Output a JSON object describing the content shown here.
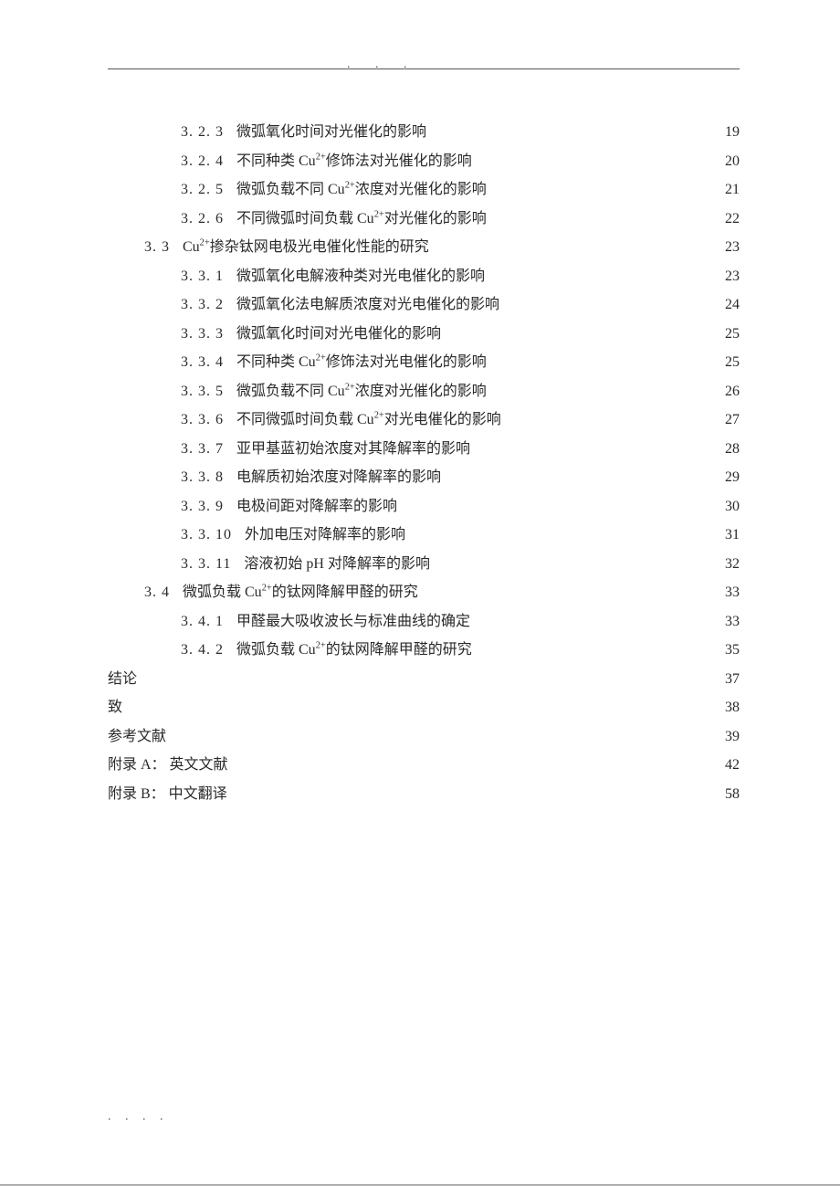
{
  "header_dots": ". . .",
  "footer_dots": ". . . .",
  "toc": [
    {
      "indent": 2,
      "num": "3. 2. 3",
      "title_html": "微弧氧化时间对光催化的影响",
      "page": "19"
    },
    {
      "indent": 2,
      "num": "3. 2. 4",
      "title_html": "不同种类 Cu<sup>2+</sup>修饰法对光催化的影响",
      "page": "20"
    },
    {
      "indent": 2,
      "num": "3. 2. 5",
      "title_html": "微弧负载不同 Cu<sup>2+</sup>浓度对光催化的影响",
      "page": "21"
    },
    {
      "indent": 2,
      "num": "3. 2. 6",
      "title_html": "不同微弧时间负载 Cu<sup>2+</sup>对光催化的影响",
      "page": "22"
    },
    {
      "indent": 1,
      "num": "3. 3",
      "title_html": "Cu<sup>2+</sup>掺杂钛网电极光电催化性能的研究",
      "page": "23"
    },
    {
      "indent": 2,
      "num": "3. 3. 1",
      "title_html": "微弧氧化电解液种类对光电催化的影响",
      "page": "23"
    },
    {
      "indent": 2,
      "num": "3. 3. 2",
      "title_html": "微弧氧化法电解质浓度对光电催化的影响",
      "page": "24"
    },
    {
      "indent": 2,
      "num": "3. 3. 3",
      "title_html": "微弧氧化时间对光电催化的影响",
      "page": "25"
    },
    {
      "indent": 2,
      "num": "3. 3. 4",
      "title_html": " 不同种类 Cu<sup>2+</sup>修饰法对光电催化的影响",
      "page": "25"
    },
    {
      "indent": 2,
      "num": "3. 3. 5",
      "title_html": "微弧负载不同 Cu<sup>2+</sup>浓度对光催化的影响",
      "page": "26"
    },
    {
      "indent": 2,
      "num": "3. 3. 6",
      "title_html": "不同微弧时间负载 Cu<sup>2+</sup>对光电催化的影响",
      "page": "27"
    },
    {
      "indent": 2,
      "num": "3. 3. 7",
      "title_html": "亚甲基蓝初始浓度对其降解率的影响",
      "page": "28"
    },
    {
      "indent": 2,
      "num": "3. 3. 8",
      "title_html": "电解质初始浓度对降解率的影响",
      "page": "29"
    },
    {
      "indent": 2,
      "num": "3. 3. 9",
      "title_html": "电极间距对降解率的影响",
      "page": "30"
    },
    {
      "indent": 2,
      "num": "3. 3. 10",
      "title_html": " 外加电压对降解率的影响",
      "page": "31"
    },
    {
      "indent": 2,
      "num": "3. 3. 11",
      "title_html": " 溶液初始 pH 对降解率的影响",
      "page": "32"
    },
    {
      "indent": 1,
      "num": "3. 4",
      "title_html": " 微弧负载 Cu<sup>2+</sup>的钛网降解甲醛的研究 ",
      "page": "33"
    },
    {
      "indent": 2,
      "num": "3. 4. 1",
      "title_html": "甲醛最大吸收波长与标准曲线的确定",
      "page": "33"
    },
    {
      "indent": 2,
      "num": "3. 4. 2",
      "title_html": "微弧负载 Cu<sup>2+</sup>的钛网降解甲醛的研究",
      "page": "35"
    },
    {
      "indent": 0,
      "num": "",
      "title_html": "结论",
      "page": "37"
    },
    {
      "indent": 0,
      "num": "",
      "title_html": "致",
      "page": "38"
    },
    {
      "indent": 0,
      "num": "",
      "title_html": "参考文献",
      "page": "39"
    },
    {
      "indent": 0,
      "num": "",
      "title_html": "附录 A： 英文文献",
      "page": "42"
    },
    {
      "indent": 0,
      "num": "",
      "title_html": "附录 B： 中文翻译",
      "page": "58"
    }
  ]
}
